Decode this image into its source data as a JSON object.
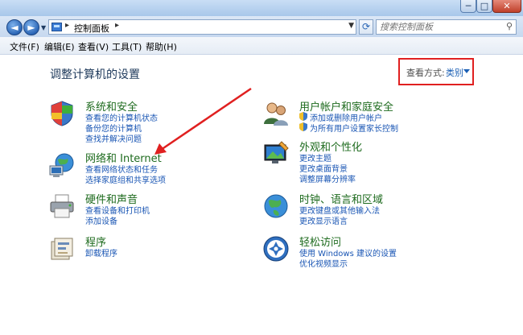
{
  "window": {
    "buttons": {
      "minimize": "─",
      "maximize": "□",
      "close": "✕"
    }
  },
  "nav": {
    "back_glyph": "◄",
    "forward_glyph": "►",
    "address_crumb": "控制面板",
    "search_placeholder": "搜索控制面板",
    "refresh_glyph": "⟳"
  },
  "menubar": {
    "items": [
      "文件(F)",
      "编辑(E)",
      "查看(V)",
      "工具(T)",
      "帮助(H)"
    ]
  },
  "content": {
    "heading": "调整计算机的设置",
    "view_by": {
      "label": "查看方式:",
      "value": "类别"
    }
  },
  "categories": {
    "system_security": {
      "title": "系统和安全",
      "links": [
        "查看您的计算机状态",
        "备份您的计算机",
        "查找并解决问题"
      ]
    },
    "network_internet": {
      "title": "网络和 Internet",
      "links": [
        "查看网络状态和任务",
        "选择家庭组和共享选项"
      ]
    },
    "hardware_sound": {
      "title": "硬件和声音",
      "links": [
        "查看设备和打印机",
        "添加设备"
      ]
    },
    "programs": {
      "title": "程序",
      "links": [
        "卸载程序"
      ]
    },
    "user_accounts": {
      "title": "用户帐户和家庭安全",
      "links": [
        "添加或删除用户帐户",
        "为所有用户设置家长控制"
      ]
    },
    "appearance": {
      "title": "外观和个性化",
      "links": [
        "更改主题",
        "更改桌面背景",
        "调整屏幕分辨率"
      ]
    },
    "clock_region": {
      "title": "时钟、语言和区域",
      "links": [
        "更改键盘或其他输入法",
        "更改显示语言"
      ]
    },
    "ease_access": {
      "title": "轻松访问",
      "links": [
        "使用 Windows 建议的设置",
        "优化视频显示"
      ]
    }
  },
  "colors": {
    "category_title": "#1e6b1e",
    "link": "#1a56b4",
    "heading": "#1e395b",
    "annotation_red": "#e02020"
  }
}
